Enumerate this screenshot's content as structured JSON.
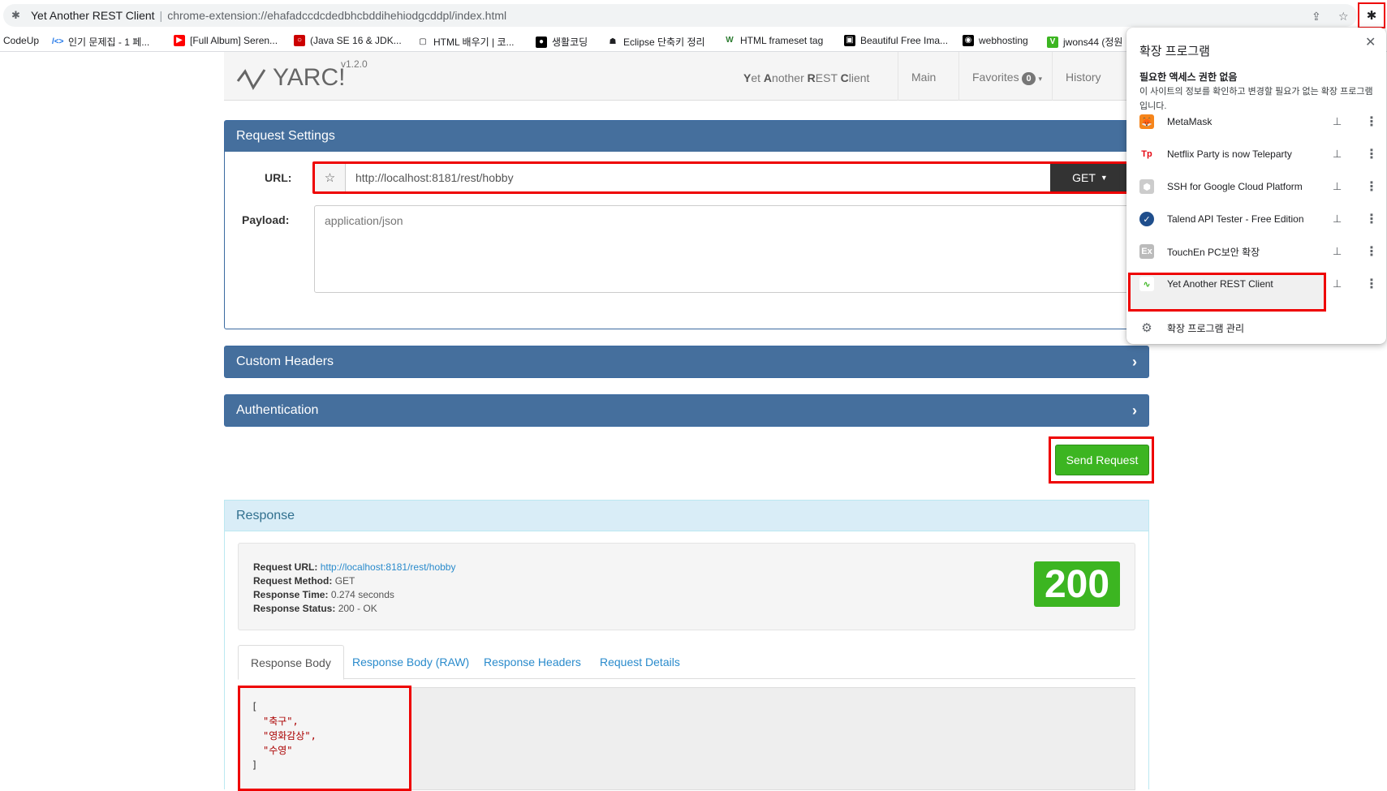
{
  "browser": {
    "tab_title": "Yet Another REST Client",
    "url": "chrome-extension://ehafadccdcdedbhcbddihehiodgcddpl/index.html",
    "bookmarks": [
      {
        "label": "CodeUp",
        "color": "#ffffff",
        "text_color": "#202124",
        "glyph": ""
      },
      {
        "label": "인기 문제집 - 1 페...",
        "color": "#ffffff",
        "text_color": "#1a73e8",
        "glyph": "/<>"
      },
      {
        "label": "[Full Album] Seren...",
        "color": "#ff0000",
        "text_color": "#ffffff",
        "glyph": "▶"
      },
      {
        "label": "(Java SE 16 & JDK...",
        "color": "#cc0000",
        "text_color": "#ffffff",
        "glyph": "○"
      },
      {
        "label": "HTML 배우기 | 코...",
        "color": "#ffffff",
        "text_color": "#202124",
        "glyph": "▢"
      },
      {
        "label": "생활코딩",
        "color": "#000000",
        "text_color": "#ffffff",
        "glyph": "●"
      },
      {
        "label": "Eclipse 단축키 정리",
        "color": "#ffffff",
        "text_color": "#202124",
        "glyph": "☗"
      },
      {
        "label": "HTML frameset tag",
        "color": "#ffffff",
        "text_color": "#2e7d32",
        "glyph": "W"
      },
      {
        "label": "Beautiful Free Ima...",
        "color": "#000000",
        "text_color": "#ffffff",
        "glyph": "▣"
      },
      {
        "label": "webhosting",
        "color": "#000000",
        "text_color": "#ffffff",
        "glyph": "◉"
      },
      {
        "label": "jwons44 (정원",
        "color": "#3cb521",
        "text_color": "#ffffff",
        "glyph": "V"
      }
    ]
  },
  "app": {
    "logo_text": "YARC!",
    "version": "v1.2.0",
    "name_parts": [
      "Y",
      "et ",
      "A",
      "nother ",
      "R",
      "EST ",
      "C",
      "lient"
    ],
    "nav": {
      "main": "Main",
      "favorites": "Favorites",
      "favorites_count": "0",
      "history": "History"
    }
  },
  "request_settings": {
    "title": "Request Settings",
    "url_label": "URL:",
    "url_value": "http://localhost:8181/rest/hobby",
    "method": "GET",
    "payload_label": "Payload:",
    "payload_placeholder": "application/json"
  },
  "custom_headers": {
    "title": "Custom Headers"
  },
  "authentication": {
    "title": "Authentication"
  },
  "send_button": "Send Request",
  "response": {
    "title": "Response",
    "request_url_label": "Request URL:",
    "request_url": "http://localhost:8181/rest/hobby",
    "request_method_label": "Request Method:",
    "request_method": "GET",
    "response_time_label": "Response Time:",
    "response_time": "0.274 seconds",
    "response_status_label": "Response Status:",
    "response_status": "200 - OK",
    "status_code": "200",
    "tabs": [
      "Response Body",
      "Response Body (RAW)",
      "Response Headers",
      "Request Details"
    ],
    "body_open": "[",
    "body_items": [
      "\"축구\",",
      "\"영화감상\",",
      "\"수영\""
    ],
    "body_close": "]"
  },
  "extensions_popup": {
    "title": "확장 프로그램",
    "subtitle": "필요한 액세스 권한 없음",
    "description": "이 사이트의 정보를 확인하고 변경할 필요가 없는 확장 프로그램입니다.",
    "items": [
      {
        "name": "MetaMask",
        "icon": "fox-icon",
        "color": "#f6851b",
        "glyph": "🦊"
      },
      {
        "name": "Netflix Party is now Teleparty",
        "icon": "teleparty-icon",
        "color": "#ffffff",
        "glyph": "Tp"
      },
      {
        "name": "SSH for Google Cloud Platform",
        "icon": "ssh-icon",
        "color": "#cccccc",
        "glyph": "⬢"
      },
      {
        "name": "Talend API Tester - Free Edition",
        "icon": "talend-icon",
        "color": "#1f4e8c",
        "glyph": "✓"
      },
      {
        "name": "TouchEn PC보안 확장",
        "icon": "touchen-icon",
        "color": "#bbbbbb",
        "glyph": "Ex"
      },
      {
        "name": "Yet Another REST Client",
        "icon": "yarc-icon",
        "color": "#ffffff",
        "glyph": "∿"
      }
    ],
    "manage": "확장 프로그램 관리"
  }
}
